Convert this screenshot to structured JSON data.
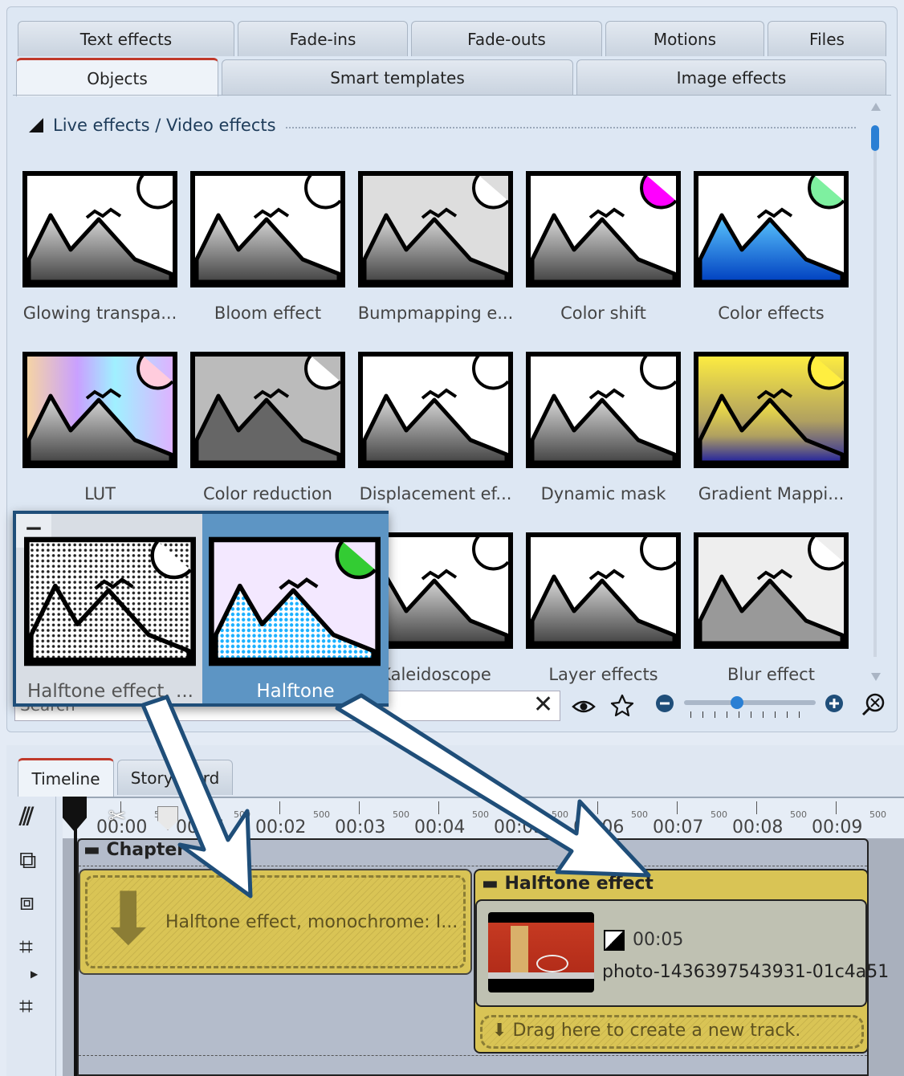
{
  "tabs_row1": [
    {
      "label": "Text effects"
    },
    {
      "label": "Fade-ins"
    },
    {
      "label": "Fade-outs"
    },
    {
      "label": "Motions"
    },
    {
      "label": "Files"
    }
  ],
  "tabs_row2": [
    {
      "label": "Objects",
      "active": true
    },
    {
      "label": "Smart templates"
    },
    {
      "label": "Image effects"
    }
  ],
  "section": {
    "title": "Live effects / Video effects"
  },
  "effects": [
    {
      "label": "Glowing transpa...",
      "style": "glow"
    },
    {
      "label": "Bloom effect",
      "style": "bloom"
    },
    {
      "label": "Bumpmapping e...",
      "style": "bump"
    },
    {
      "label": "Color shift",
      "style": "shift"
    },
    {
      "label": "Color effects",
      "style": "color"
    },
    {
      "label": "LUT",
      "style": "lut"
    },
    {
      "label": "Color reduction",
      "style": "reduce"
    },
    {
      "label": "Displacement ef...",
      "style": "disp"
    },
    {
      "label": "Dynamic mask",
      "style": "mask"
    },
    {
      "label": "Gradient Mappi...",
      "style": "grad"
    },
    {
      "label": "Kaleidoscope",
      "style": "kal"
    },
    {
      "label": "Layer effects",
      "style": "layer"
    },
    {
      "label": "Blur effect",
      "style": "blur"
    }
  ],
  "popup": {
    "items": [
      {
        "label": "Halftone effect, ..."
      },
      {
        "label": "Halftone",
        "selected": true
      }
    ]
  },
  "search": {
    "placeholder": "Search",
    "value": ""
  },
  "toolbar_icons": [
    "clear-icon",
    "eye-icon",
    "star-icon",
    "zoom-out-icon",
    "zoom-slider",
    "zoom-in-icon",
    "zoom-fit-icon"
  ],
  "zoom_level": 0.4,
  "timeline": {
    "tabs": [
      {
        "label": "Timeline",
        "active": true
      },
      {
        "label": "Storyboard"
      }
    ],
    "ruler": [
      "00:00",
      "00:01",
      "00:02",
      "00:03",
      "00:04",
      "00:05",
      "00:06",
      "00:07",
      "00:08",
      "00:09"
    ],
    "ruler_sub": "500",
    "chapter": "Chapter",
    "drop_item": "Halftone effect, monochrome: I...",
    "effect_block": {
      "title": "Halftone effect",
      "duration": "00:05",
      "filename": "photo-1436397543931-01c4a51",
      "drop_hint": "Drag here to create a new track."
    }
  },
  "colors": {
    "accent_tab": "#c0392b",
    "popup_border": "#1f4e79",
    "selected": "#5d95c4",
    "effect_yellow": "#d9c455",
    "scroll": "#2a7fd4"
  }
}
